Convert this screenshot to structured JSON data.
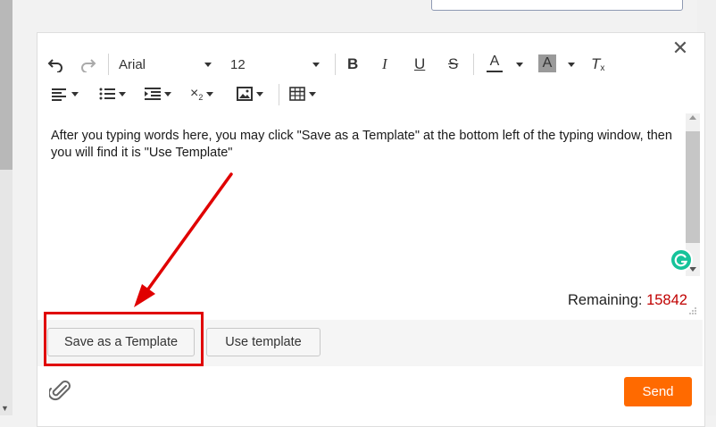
{
  "toolbar": {
    "font_name": "Arial",
    "font_size": "12",
    "icons": {
      "undo": "undo-icon",
      "redo": "redo-icon",
      "bold": "bold-icon",
      "italic": "italic-icon",
      "underline": "underline-icon",
      "strikethrough": "strikethrough-icon",
      "text_color": "text-color-icon",
      "highlight": "highlight-icon",
      "clear_format": "clear-format-icon",
      "align": "align-icon",
      "list": "list-icon",
      "indent": "indent-icon",
      "subscript": "subscript-icon",
      "image": "image-icon",
      "table": "table-icon"
    }
  },
  "editor": {
    "content": "After you typing words here, you may click \"Save as a Template\" at the bottom left of the typing window, then you will find it is \"Use Template\""
  },
  "counter": {
    "label": "Remaining:",
    "value": "15842"
  },
  "buttons": {
    "save_template": "Save as a Template",
    "use_template": "Use template",
    "send": "Send"
  },
  "colors": {
    "accent": "#ff6a00",
    "annotation": "#e00000",
    "counter_value": "#c00000",
    "grammarly": "#15c39a"
  }
}
